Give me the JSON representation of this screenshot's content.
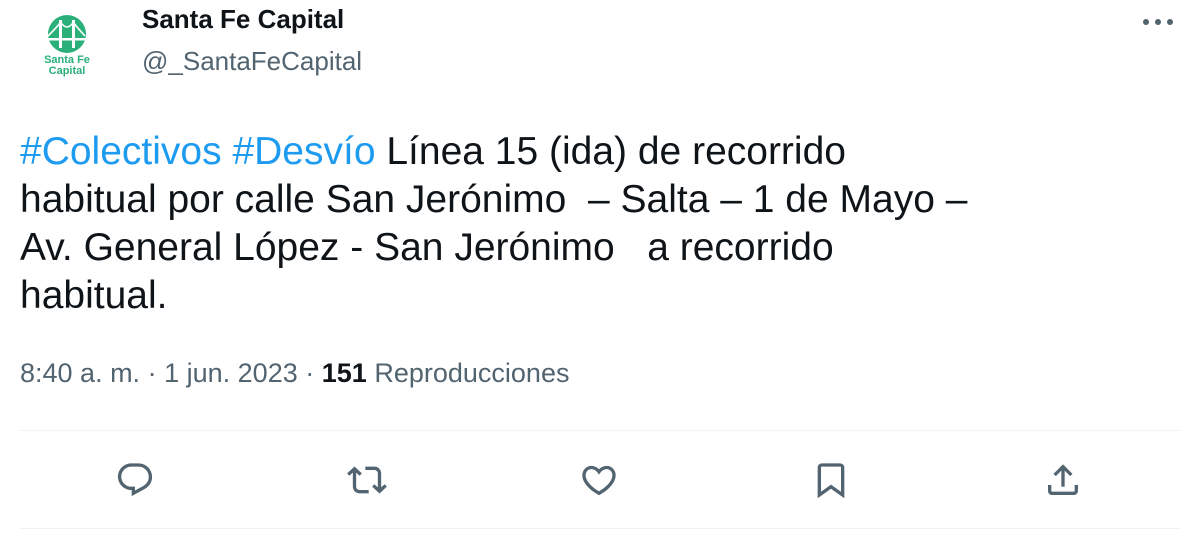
{
  "author": {
    "display_name": "Santa Fe Capital",
    "handle": "@_SantaFeCapital",
    "avatar_text": "Santa Fe\nCapital",
    "avatar_icon": "bridge-logo-icon",
    "brand_color": "#2bb07a"
  },
  "tweet": {
    "hashtags": [
      "#Colectivos",
      "#Desvío"
    ],
    "text_line1_rest": "Línea 15 (ida) de recorrido",
    "text_line2": "habitual por calle San Jerónimo  – Salta – 1 de Mayo –",
    "text_line3": "Av. General López - San Jerónimo   a recorrido",
    "text_line4": "habitual."
  },
  "meta": {
    "time": "8:40 a. m.",
    "separator": "·",
    "date": "1 jun. 2023",
    "views_count": "151",
    "views_label": "Reproducciones"
  },
  "actions": [
    {
      "name": "reply",
      "icon": "reply-icon"
    },
    {
      "name": "retweet",
      "icon": "retweet-icon"
    },
    {
      "name": "like",
      "icon": "heart-icon"
    },
    {
      "name": "bookmark",
      "icon": "bookmark-icon"
    },
    {
      "name": "share",
      "icon": "share-icon"
    }
  ],
  "colors": {
    "link": "#1d9bf0",
    "secondary_text": "#536471",
    "primary_text": "#0f1419",
    "divider": "#eff3f4"
  }
}
